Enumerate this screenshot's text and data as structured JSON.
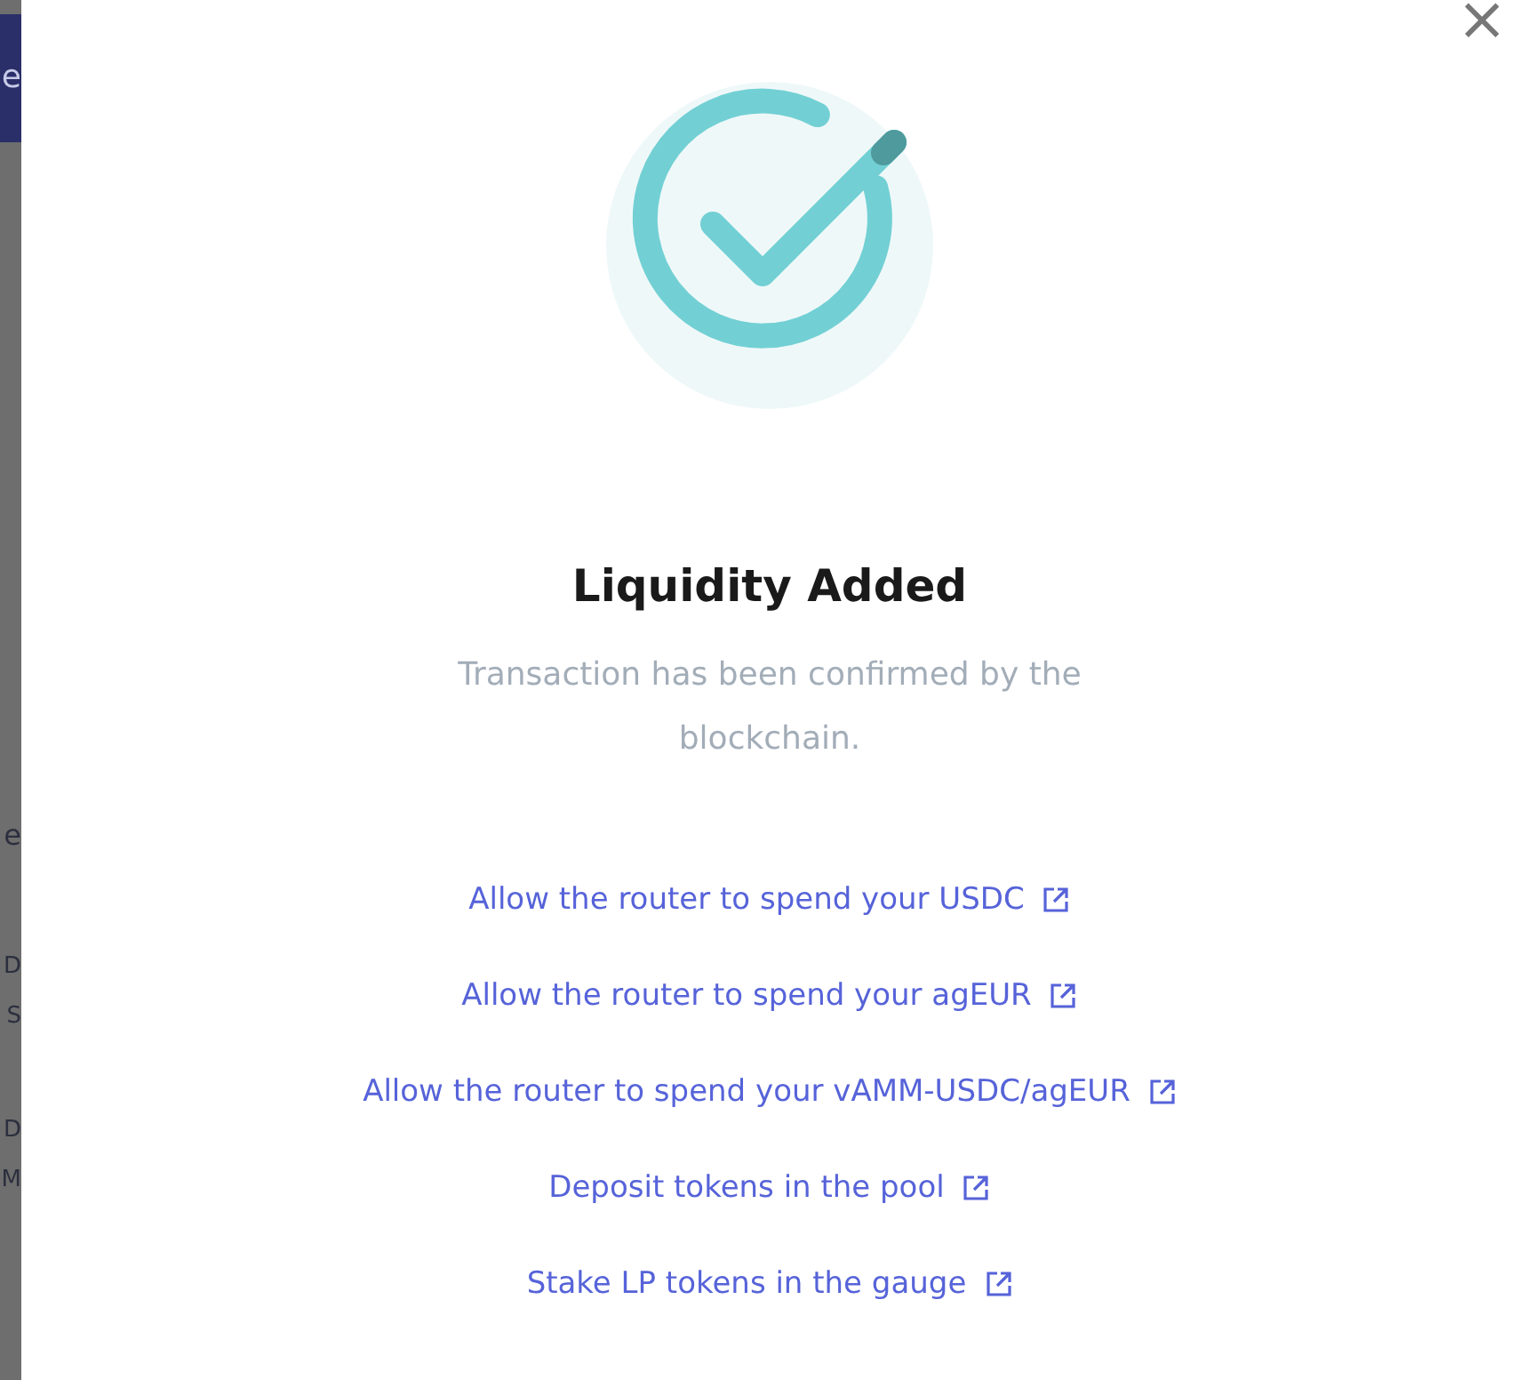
{
  "background": {
    "fragments": [
      {
        "text": "e",
        "kind": "header"
      },
      {
        "text": "e",
        "kind": "heading"
      },
      {
        "text": "D",
        "kind": "row"
      },
      {
        "text": "S",
        "kind": "row"
      },
      {
        "text": "D",
        "kind": "row"
      },
      {
        "text": "M",
        "kind": "row"
      }
    ]
  },
  "modal": {
    "close": "×",
    "title": "Liquidity Added",
    "message": "Transaction has been confirmed by the blockchain.",
    "links": [
      "Allow the router to spend your USDC",
      "Allow the router to spend your agEUR",
      "Allow the router to spend your vAMM-USDC/agEUR",
      "Deposit tokens in the pool",
      "Stake LP tokens in the gauge"
    ]
  }
}
